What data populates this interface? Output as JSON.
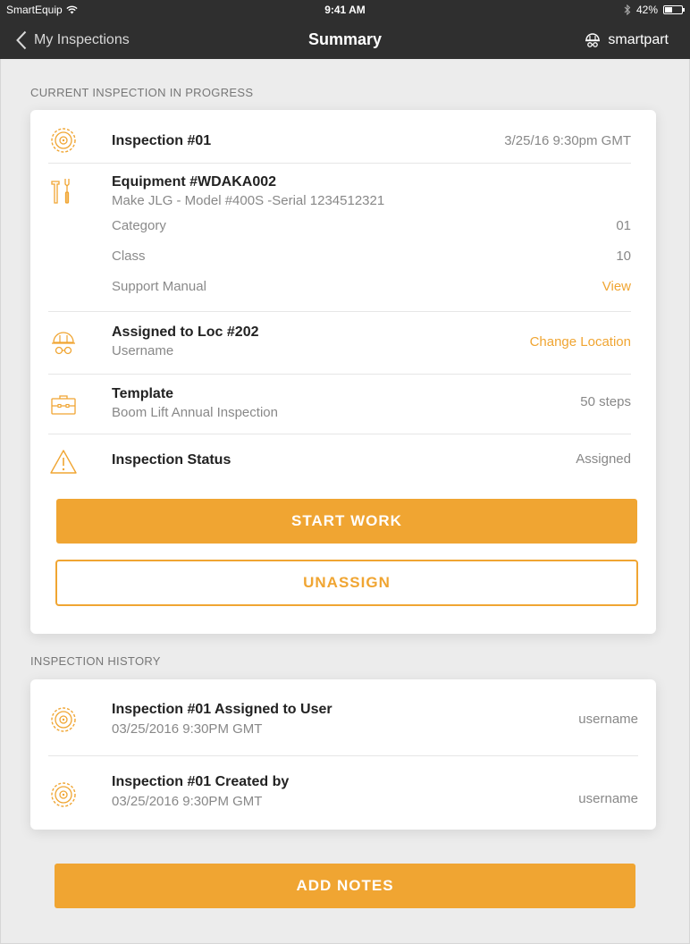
{
  "status_bar": {
    "carrier": "SmartEquip",
    "time": "9:41 AM",
    "battery": "42%",
    "battery_level": 0.42
  },
  "nav": {
    "back_label": "My Inspections",
    "title": "Summary",
    "brand": "smartpart"
  },
  "current": {
    "section_label": "CURRENT INSPECTION IN PROGRESS",
    "inspection": {
      "title": "Inspection #01",
      "date": "3/25/16 9:30pm GMT"
    },
    "equipment": {
      "title": "Equipment #WDAKA002",
      "subtitle": "Make JLG - Model #400S -Serial 1234512321",
      "details": [
        {
          "label": "Category",
          "value": "01"
        },
        {
          "label": "Class",
          "value": "10"
        },
        {
          "label": "Support Manual",
          "value": "View"
        }
      ]
    },
    "assigned": {
      "title": "Assigned to Loc #202",
      "subtitle": "Username",
      "action": "Change Location"
    },
    "template": {
      "title": "Template",
      "subtitle": "Boom Lift Annual Inspection",
      "value": "50 steps"
    },
    "status": {
      "title": "Inspection Status",
      "value": "Assigned"
    },
    "start_button": "START WORK",
    "unassign_button": "UNASSIGN"
  },
  "history": {
    "section_label": "INSPECTION HISTORY",
    "items": [
      {
        "title": "Inspection #01 Assigned to User",
        "date": "03/25/2016 9:30PM GMT",
        "user": "username"
      },
      {
        "title": "Inspection #01 Created by",
        "date": "03/25/2016 9:30PM GMT",
        "user": "username"
      }
    ]
  },
  "add_notes_button": "ADD NOTES",
  "colors": {
    "accent": "#f0a532",
    "bar": "#2f2f2f",
    "background": "#ececec"
  },
  "icons": {
    "inspection": "saw-blade-icon",
    "equipment": "tools-icon",
    "assigned": "hardhat-worker-icon",
    "template": "toolbox-icon",
    "status": "warning-icon"
  }
}
